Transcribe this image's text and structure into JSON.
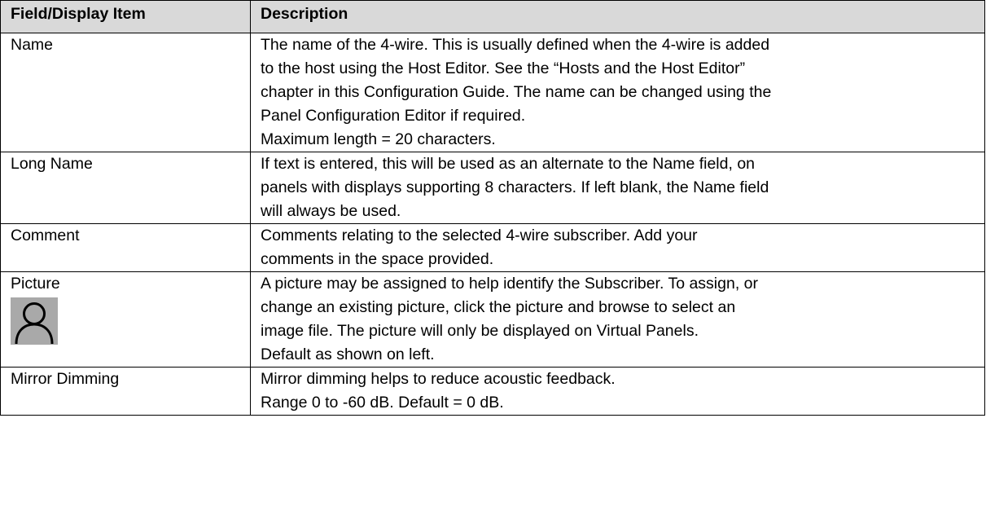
{
  "table": {
    "headers": {
      "field": "Field/Display Item",
      "description": "Description"
    },
    "rows": [
      {
        "field": "Name",
        "description": [
          "The name of the 4-wire. This is usually defined when the 4-wire is added",
          "to the host using the Host Editor. See the “Hosts and the Host Editor”",
          "chapter in this Configuration Guide. The name can be changed using the",
          "Panel Configuration Editor if required.",
          "Maximum length = 20 characters."
        ]
      },
      {
        "field": "Long Name",
        "description": [
          "If text is entered, this will be used as an alternate to the Name field, on",
          "panels with displays supporting 8 characters. If left blank, the Name field",
          "will always be used."
        ]
      },
      {
        "field": "Comment",
        "description": [
          "Comments relating to the selected 4-wire subscriber. Add your",
          "comments in the space provided."
        ]
      },
      {
        "field": "Picture",
        "icon": "person-avatar-icon",
        "description": [
          "A picture may be assigned to help identify the Subscriber. To assign, or",
          "change an existing picture, click the picture and browse to select an",
          "image file. The picture will only be displayed on Virtual Panels.",
          "Default as shown on left."
        ]
      },
      {
        "field": "Mirror Dimming",
        "description": [
          "Mirror dimming helps to reduce acoustic feedback.",
          "Range 0 to -60 dB. Default = 0 dB."
        ]
      }
    ]
  },
  "colors": {
    "header_background": "#d9d9d9",
    "border": "#000000",
    "avatar_background": "#a9a9a9"
  }
}
